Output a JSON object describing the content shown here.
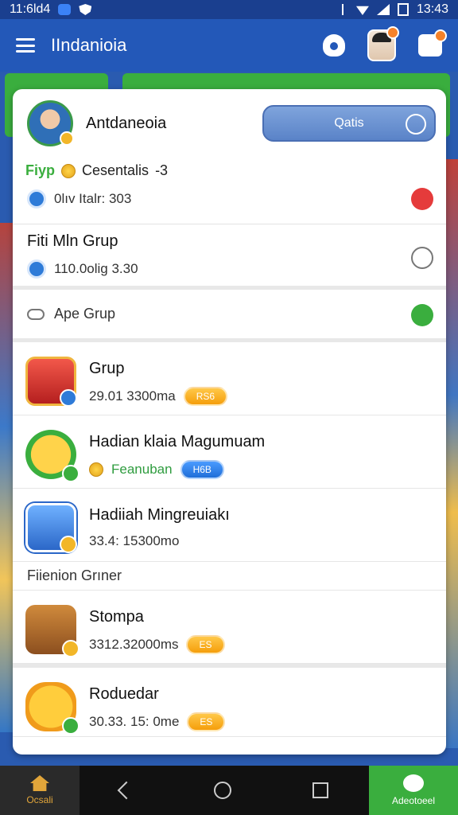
{
  "status_bar": {
    "time_left": "11:6ld4",
    "time_right": "13:43"
  },
  "app_bar": {
    "title": "IIndanioia"
  },
  "profile": {
    "name": "Antdaneoia",
    "button_label": "Qatis",
    "level_label": "Fiyp",
    "level_coin_text": "Cesentalis",
    "level_value": "-3",
    "sub_text": "0lıv Italr: 303"
  },
  "group_first": {
    "title": "Fiti Mln Grup",
    "sub": "110.0olig 3.30"
  },
  "group_second": {
    "title": "Ape Grup"
  },
  "items": [
    {
      "title": "Grup",
      "sub": "29.01 3300ma",
      "pill": "RS6"
    },
    {
      "title": "Hadian klaia Magumuam",
      "sub": "Feanuban",
      "pill": "H6B"
    },
    {
      "title": "Hadiiah Mingreuiakı",
      "sub": "33.4: 15300mo",
      "pill": ""
    }
  ],
  "section_label": "Fiienion Grıner",
  "items_lower": [
    {
      "title": "Stompa",
      "sub": "3312.32000ms",
      "pill": "ES"
    },
    {
      "title": "Roduedar",
      "sub": "30.33. 15: 0me",
      "pill": "ES"
    }
  ],
  "nav": {
    "home_label": "Ocsali",
    "right_label": "Adeotoeel"
  },
  "colors": {
    "primary": "#2358b8",
    "green": "#3aae3e",
    "orange": "#f59e0b"
  }
}
